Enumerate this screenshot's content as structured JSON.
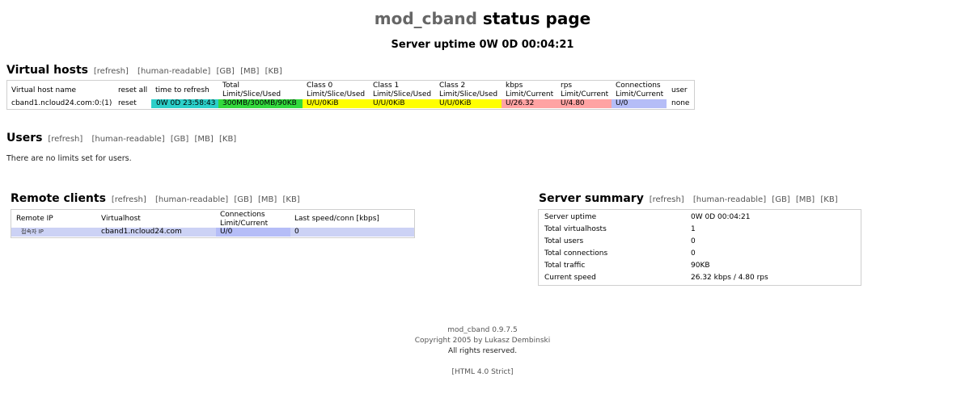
{
  "title": {
    "mod": "mod_cband",
    "rest": "status page"
  },
  "uptime_line": "Server uptime 0W 0D 00:04:21",
  "vhosts": {
    "heading": "Virtual hosts",
    "links": [
      "[refresh]",
      "[human-readable]",
      "[GB]",
      "[MB]",
      "[KB]"
    ],
    "headers": {
      "name": "Virtual host name",
      "reset": "reset all",
      "time": "time to refresh",
      "total": [
        "Total",
        "Limit/Slice/Used"
      ],
      "class0": [
        "Class 0",
        "Limit/Slice/Used"
      ],
      "class1": [
        "Class 1",
        "Limit/Slice/Used"
      ],
      "class2": [
        "Class 2",
        "Limit/Slice/Used"
      ],
      "kbps": [
        "kbps",
        "Limit/Current"
      ],
      "rps": [
        "rps",
        "Limit/Current"
      ],
      "conn": [
        "Connections",
        "Limit/Current"
      ],
      "user": "user"
    },
    "row": {
      "name": "cband1.ncloud24.com:0:(1)",
      "reset": "reset",
      "time": "0W 0D 23:58:43",
      "total": "300MB/300MB/90KB",
      "class0": "U/U/0KiB",
      "class1": "U/U/0KiB",
      "class2": "U/U/0KiB",
      "kbps": "U/26.32",
      "rps": "U/4.80",
      "conn": "U/0",
      "user": "none"
    },
    "colors": {
      "time": "#2ccfc9",
      "total": "#33d93d",
      "class": "#ffff00",
      "rate": "#ffa3a3",
      "conn": "#b5bdf7"
    }
  },
  "users": {
    "heading": "Users",
    "links": [
      "[refresh]",
      "[human-readable]",
      "[GB]",
      "[MB]",
      "[KB]"
    ],
    "message": "There are no limits set for users."
  },
  "clients": {
    "heading": "Remote clients",
    "links": [
      "[refresh]",
      "[human-readable]",
      "[GB]",
      "[MB]",
      "[KB]"
    ],
    "headers": {
      "ip": "Remote IP",
      "vhost": "Virtualhost",
      "conn": [
        "Connections",
        "Limit/Current"
      ],
      "speed": "Last speed/conn [kbps]"
    },
    "row": {
      "ip": "접속자 IP",
      "vhost": "cband1.ncloud24.com",
      "conn": "U/0",
      "speed": "0"
    },
    "colors": {
      "row": "#ccd2f5",
      "conn": "#b5bdf7"
    }
  },
  "summary": {
    "heading": "Server summary",
    "links": [
      "[refresh]",
      "[human-readable]",
      "[GB]",
      "[MB]",
      "[KB]"
    ],
    "rows": [
      {
        "label": "Server uptime",
        "value": "0W 0D 00:04:21"
      },
      {
        "label": "Total virtualhosts",
        "value": "1"
      },
      {
        "label": "Total users",
        "value": "0"
      },
      {
        "label": "Total connections",
        "value": "0"
      },
      {
        "label": "Total traffic",
        "value": "90KB"
      },
      {
        "label": "Current speed",
        "value": "26.32 kbps / 4.80 rps"
      }
    ]
  },
  "footer": {
    "line1": "mod_cband 0.9.7.5",
    "line2": "Copyright 2005 by Lukasz Dembinski",
    "line3": "All rights reserved.",
    "html_link": "[HTML 4.0 Strict]"
  }
}
